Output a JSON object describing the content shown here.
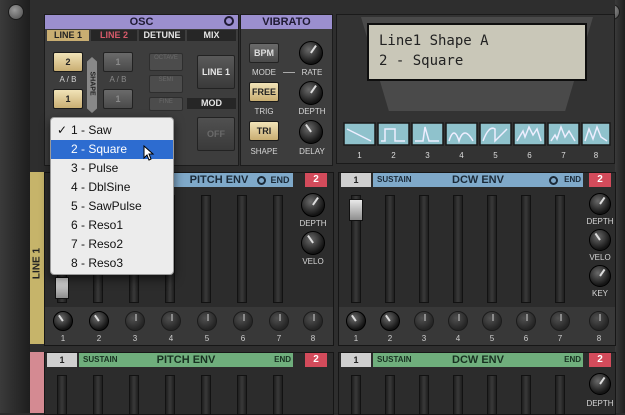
{
  "osc": {
    "title": "OSC",
    "tabs": [
      "LINE 1",
      "LINE 2",
      "DETUNE",
      "MIX"
    ],
    "line1_top": "2",
    "line1_bottom": "1",
    "line2_top": "1",
    "line2_bottom": "1",
    "ab": "A / B",
    "shape_label": "SHAPE",
    "mix_button": "LINE 1",
    "mod_label": "MOD",
    "off_button": "OFF",
    "detune_labels": [
      "OCTAVE",
      "SEMI",
      "FINE"
    ]
  },
  "vibrato": {
    "title": "VIBRATO",
    "bpm": "BPM",
    "mode": "MODE",
    "rate": "RATE",
    "free": "FREE",
    "trig": "TRIG",
    "depth": "DEPTH",
    "tri": "TRI",
    "shape": "SHAPE",
    "delay": "DELAY"
  },
  "display": {
    "line1": "Line1 Shape A",
    "line2": "2 - Square"
  },
  "wave_numbers": [
    "1",
    "2",
    "3",
    "4",
    "5",
    "6",
    "7",
    "8"
  ],
  "menu": {
    "items": [
      "1 - Saw",
      "2 - Square",
      "3 - Pulse",
      "4 - DblSine",
      "5 - SawPulse",
      "6 - Reso1",
      "7 - Reso2",
      "8 - Reso3"
    ],
    "checked_index": 0,
    "selected_index": 1,
    "check_mark": "✓"
  },
  "pitch_env": {
    "title": "PITCH ENV",
    "end": "END",
    "end_value": "2",
    "depth": "DEPTH",
    "velo": "VELO",
    "numbers": [
      "1",
      "2",
      "3",
      "4",
      "5",
      "6",
      "7",
      "8"
    ]
  },
  "dcw_env": {
    "tab": "1",
    "sustain": "SUSTAIN",
    "title": "DCW ENV",
    "end": "END",
    "end_value": "2",
    "depth": "DEPTH",
    "velo": "VELO",
    "key": "KEY",
    "numbers": [
      "1",
      "2",
      "3",
      "4",
      "5",
      "6",
      "7",
      "8"
    ]
  },
  "pitch_env2": {
    "tab": "1",
    "sustain": "SUSTAIN",
    "title": "PITCH ENV",
    "end": "END",
    "end_value": "2"
  },
  "dcw_env2": {
    "tab": "1",
    "sustain": "SUSTAIN",
    "title": "DCW ENV",
    "end": "END",
    "end_value": "2",
    "depth": "DEPTH"
  },
  "side_label": "LINE 1"
}
